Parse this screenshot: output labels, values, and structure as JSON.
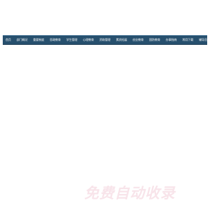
{
  "nav": {
    "items": [
      {
        "label": "首页"
      },
      {
        "label": "部门概况"
      },
      {
        "label": "重要制度"
      },
      {
        "label": "思政教育"
      },
      {
        "label": "学生管理"
      },
      {
        "label": "心理教育"
      },
      {
        "label": "资助管理"
      },
      {
        "label": "素质拓展"
      },
      {
        "label": "创业教育"
      },
      {
        "label": "国防教育"
      },
      {
        "label": "办事指南"
      },
      {
        "label": "常用下载"
      },
      {
        "label": "辅导员之家"
      }
    ]
  },
  "watermark": {
    "text": "免费自动收录"
  },
  "colors": {
    "nav_background": "#27506e",
    "nav_text": "#ffffff",
    "page_background": "#ffffff",
    "watermark": "#f8e4ea"
  }
}
